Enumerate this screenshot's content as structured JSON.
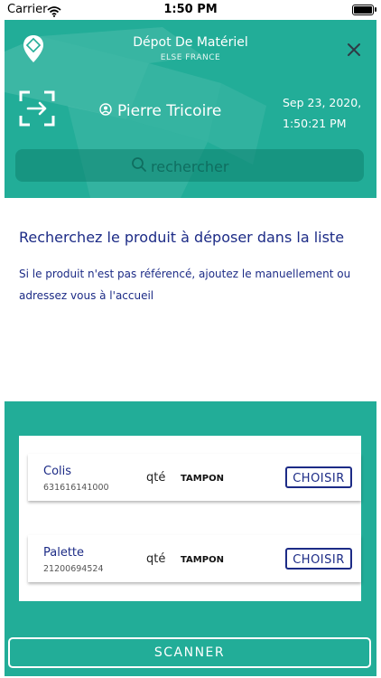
{
  "status_bar": {
    "carrier": "Carrier",
    "time": "1:50 PM"
  },
  "header": {
    "title": "Dépot De Matériel",
    "subtitle": "ELSE FRANCE",
    "user_name": "Pierre Tricoire",
    "date": "Sep 23, 2020,",
    "time": "1:50:21 PM"
  },
  "search": {
    "placeholder": "rechercher"
  },
  "info": {
    "heading": "Recherchez le produit à déposer dans la liste",
    "body": "Si le produit n'est pas référencé, ajoutez le manuellement ou adressez vous à l'accueil"
  },
  "products": [
    {
      "name": "Colis",
      "code": "631616141000",
      "qty_label": "qté",
      "tag": "TAMPON",
      "action": "CHOISIR"
    },
    {
      "name": "Palette",
      "code": "21200694524",
      "qty_label": "qté",
      "tag": "TAMPON",
      "action": "CHOISIR"
    }
  ],
  "footer": {
    "scanner_label": "SCANNER"
  },
  "colors": {
    "primary": "#22ad98",
    "text_blue": "#1c2b86",
    "white": "#ffffff"
  },
  "icons": [
    "wifi-icon",
    "battery-icon",
    "location-pin-icon",
    "close-icon",
    "scan-exit-icon",
    "user-icon",
    "search-icon"
  ]
}
